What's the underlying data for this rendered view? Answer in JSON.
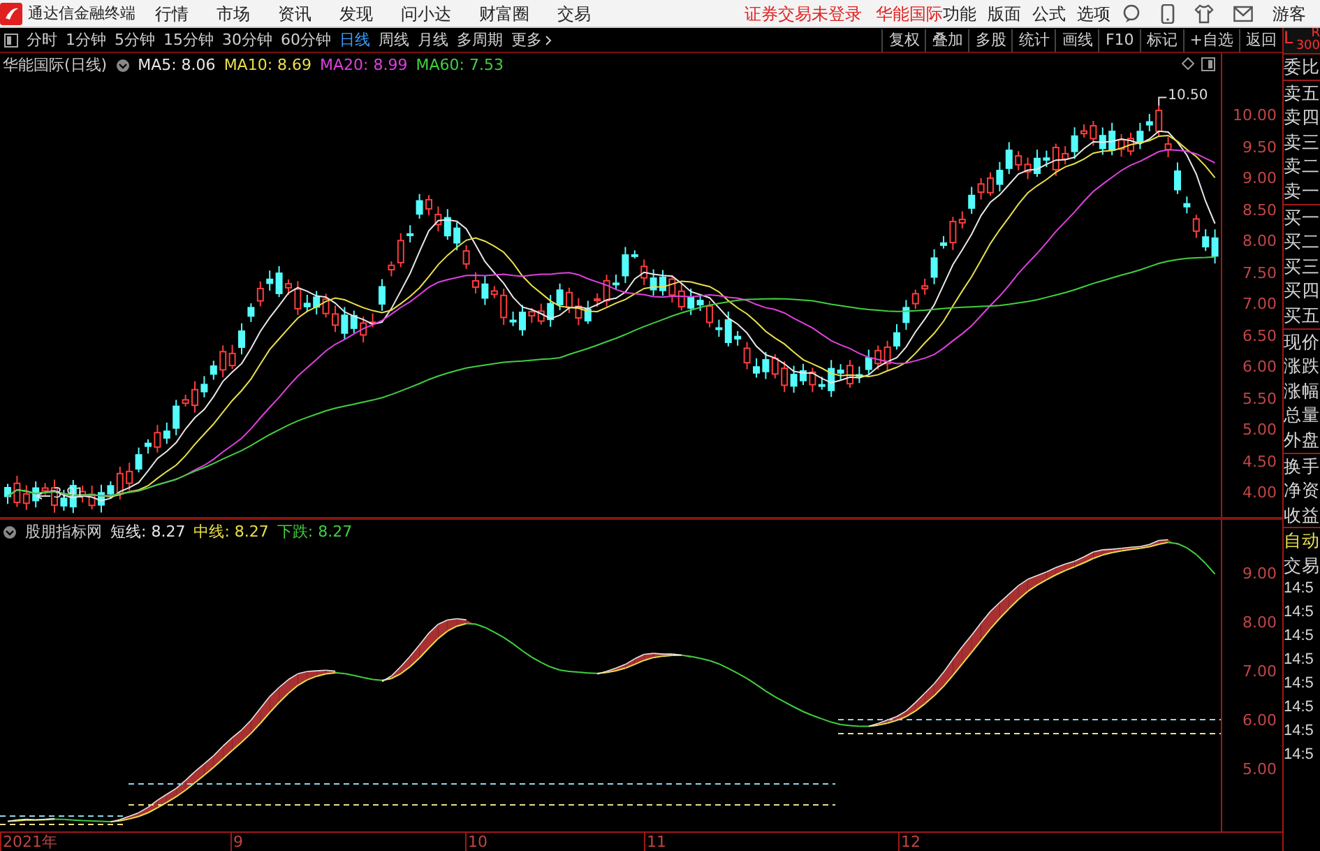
{
  "app_bar": {
    "title": "通达信金融终端",
    "menu": [
      "行情",
      "市场",
      "资讯",
      "发现",
      "问小达",
      "财富圈",
      "交易"
    ],
    "notice": "证券交易未登录",
    "stock": "华能国际",
    "actions": [
      "功能",
      "版面",
      "公式",
      "选项"
    ],
    "user": "游客"
  },
  "toolbar": {
    "periods": [
      {
        "label": "分时",
        "selected": false
      },
      {
        "label": "1分钟",
        "selected": false
      },
      {
        "label": "5分钟",
        "selected": false
      },
      {
        "label": "15分钟",
        "selected": false
      },
      {
        "label": "30分钟",
        "selected": false
      },
      {
        "label": "60分钟",
        "selected": false
      },
      {
        "label": "日线",
        "selected": true
      },
      {
        "label": "周线",
        "selected": false
      },
      {
        "label": "月线",
        "selected": false
      },
      {
        "label": "多周期",
        "selected": false
      }
    ],
    "more": "更多",
    "tools": [
      "复权",
      "叠加",
      "多股",
      "统计",
      "画线",
      "F10",
      "标记",
      "+自选",
      "返回"
    ]
  },
  "main_chart": {
    "title": "华能国际(日线)",
    "ma": [
      {
        "label": "MA5: 8.06",
        "color": "#e8e8e8"
      },
      {
        "label": "MA10: 8.69",
        "color": "#e8e04a"
      },
      {
        "label": "MA20: 8.99",
        "color": "#e040e0"
      },
      {
        "label": "MA60: 7.53",
        "color": "#40d040"
      }
    ],
    "high_label": "10.50",
    "low_label": "3.91",
    "y_axis": [
      "10.00",
      "9.50",
      "9.00",
      "8.50",
      "8.00",
      "7.50",
      "7.00",
      "6.50",
      "6.00",
      "5.50",
      "5.00",
      "4.50",
      "4.00"
    ]
  },
  "indicator": {
    "title": "股朋指标网",
    "lines": [
      {
        "label": "短线: 8.27",
        "color": "#e8e8e8"
      },
      {
        "label": "中线: 8.27",
        "color": "#e8e04a"
      },
      {
        "label": "下跌: 8.27",
        "color": "#40d040"
      }
    ],
    "y_axis": [
      "9.00",
      "8.00",
      "7.00",
      "6.00",
      "5.00"
    ]
  },
  "x_axis": [
    "2021年",
    "9",
    "10",
    "11",
    "12"
  ],
  "side_panel": {
    "corner_left": "L",
    "corner_right": "R",
    "corner_sub": "300",
    "quote_labels": [
      "委比",
      "卖五",
      "卖四",
      "卖三",
      "卖二",
      "卖一",
      "买一",
      "买二",
      "买三",
      "买四",
      "买五",
      "现价",
      "涨跌",
      "涨幅",
      "总量",
      "外盘",
      "换手",
      "净资",
      "收益"
    ],
    "mode_label": "自动",
    "trade_label": "交易",
    "times": [
      "14:5",
      "14:5",
      "14:5",
      "14:5",
      "14:5",
      "14:5",
      "14:5",
      "14:5"
    ]
  }
}
